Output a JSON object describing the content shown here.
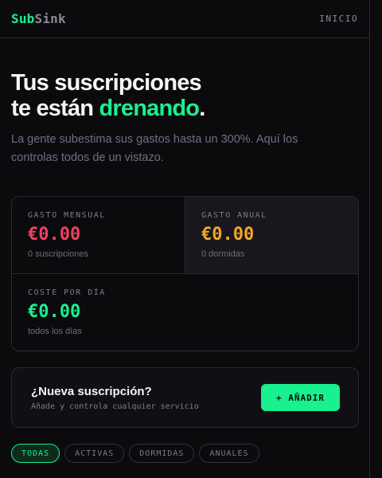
{
  "header": {
    "logo_part1": "Sub",
    "logo_part2": "Sink",
    "nav_home": "INICIO"
  },
  "hero": {
    "line1": "Tus suscripciones",
    "line2_prefix": "te están ",
    "line2_accent": "drenando",
    "line2_suffix": ".",
    "description": "La gente subestima sus gastos hasta un 300%. Aquí los controlas todos de un vistazo."
  },
  "stats": {
    "monthly": {
      "label": "GASTO MENSUAL",
      "value": "€0.00",
      "sub": "0 suscripciones"
    },
    "annual": {
      "label": "GASTO ANUAL",
      "value": "€0.00",
      "sub": "0 dormidas"
    },
    "daily": {
      "label": "COSTE POR DÍA",
      "value": "€0.00",
      "sub": "todos los días"
    }
  },
  "add_card": {
    "title": "¿Nueva suscripción?",
    "description": "Añade y controla cualquier servicio",
    "button_label": "+ AÑADIR"
  },
  "filters": {
    "tabs": [
      {
        "label": "TODAS",
        "active": true
      },
      {
        "label": "ACTIVAS",
        "active": false
      },
      {
        "label": "DORMIDAS",
        "active": false
      },
      {
        "label": "ANUALES",
        "active": false
      }
    ]
  },
  "colors": {
    "accent": "#19f08e",
    "monthly": "#f1405f",
    "annual": "#f5a623",
    "background": "#0b0b0e"
  }
}
